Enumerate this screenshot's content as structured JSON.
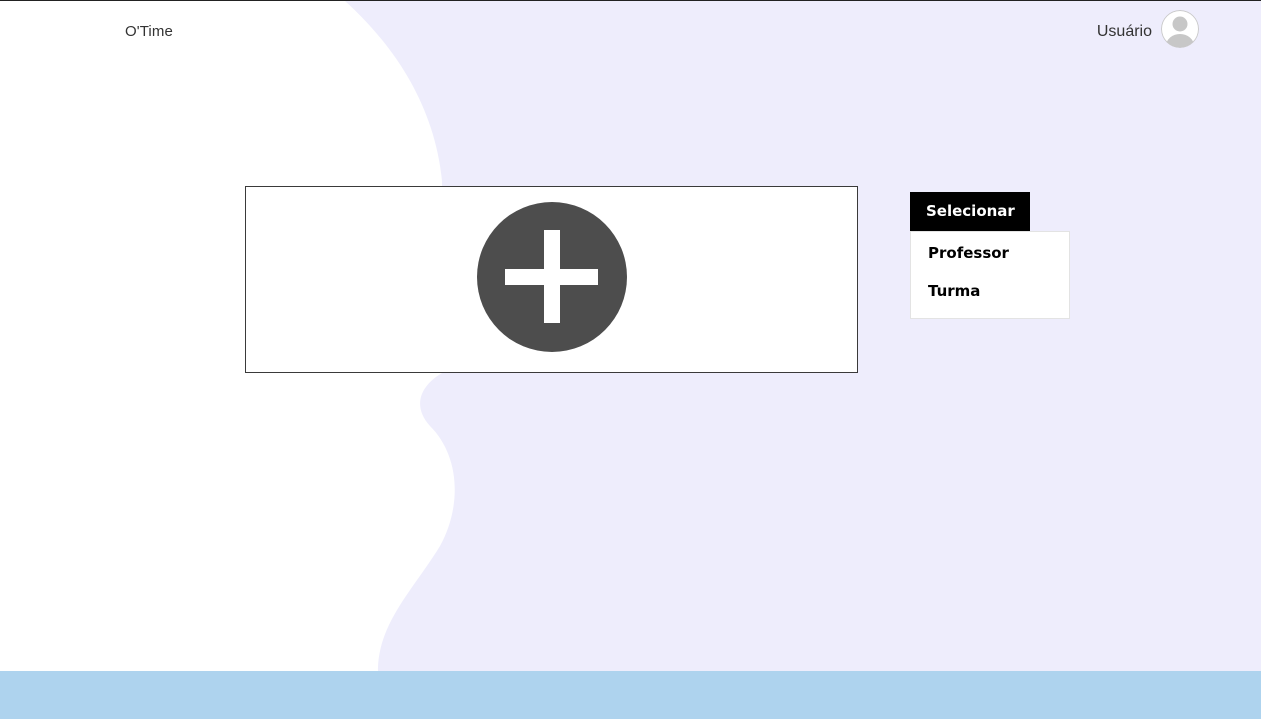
{
  "header": {
    "brand": "O'Time",
    "user_name": "Usuário",
    "avatar_icon": "user-avatar-icon"
  },
  "main": {
    "add_icon": "plus-circle-icon"
  },
  "dropdown": {
    "toggle_label": "Selecionar",
    "items": [
      {
        "label": "Professor"
      },
      {
        "label": "Turma"
      }
    ]
  },
  "colors": {
    "wave_background": "#eeedfc",
    "footer": "#aed3ee",
    "add_button": "#4d4d4d",
    "dropdown_toggle": "#000000"
  }
}
